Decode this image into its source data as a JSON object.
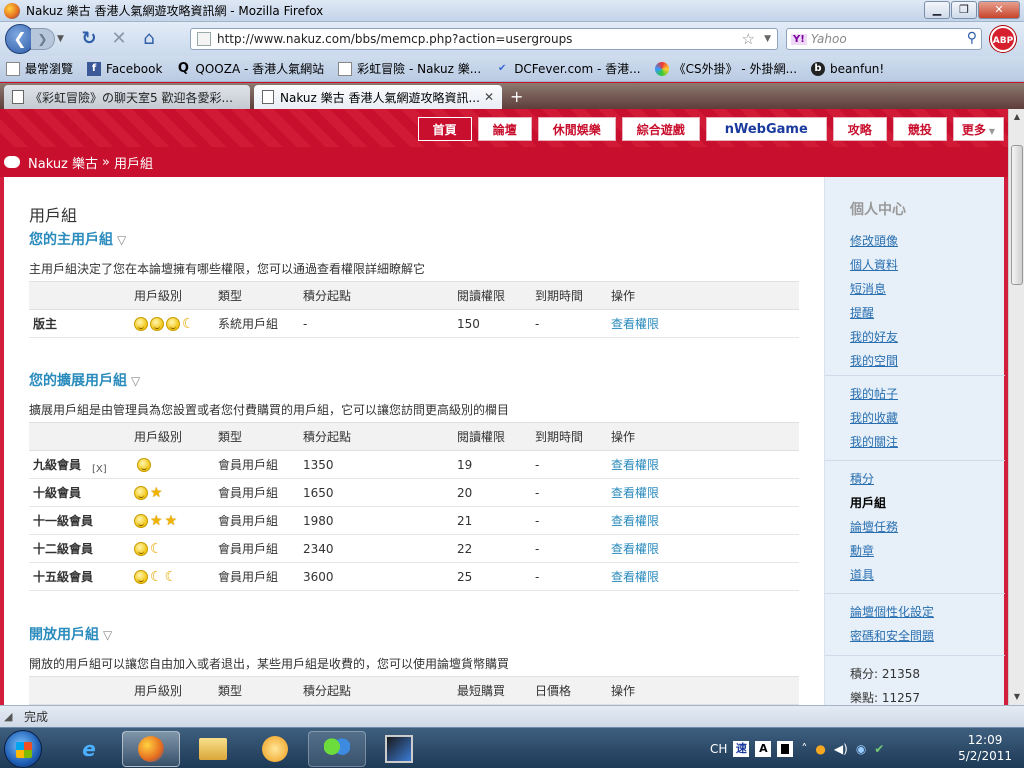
{
  "window": {
    "title": "Nakuz 樂古 香港人氣網遊攻略資訊網 - Mozilla Firefox",
    "minimize": "▁",
    "restore": "❐",
    "close": "✕"
  },
  "toolbar": {
    "back": "❮",
    "forward": "❯",
    "history_dropdown": "▼",
    "reload": "↻",
    "stop": "✕",
    "home": "⌂",
    "url": "http://www.nakuz.com/bbs/memcp.php?action=usergroups",
    "bookmark_star": "☆",
    "url_dropdown": "▼",
    "search_engine": "Y!",
    "search_placeholder": "Yahoo",
    "search_go": "⚲",
    "abp": "ABP"
  },
  "bookmarks": [
    {
      "label": "最常瀏覽",
      "icon": "bookmark-page-icon"
    },
    {
      "label": "Facebook",
      "icon": "facebook-icon"
    },
    {
      "label": "QOOZA - 香港人氣網站",
      "icon": "qooza-icon"
    },
    {
      "label": "彩虹冒險 - Nakuz 樂...",
      "icon": "page-icon"
    },
    {
      "label": "DCFever.com - 香港...",
      "icon": "dcfever-icon"
    },
    {
      "label": "《CS外掛》 - 外掛網...",
      "icon": "cs-icon"
    },
    {
      "label": "beanfun!",
      "icon": "beanfun-icon"
    }
  ],
  "bookmark_glyphs": {
    "fb": "f",
    "q": "Q",
    "dc": "✔",
    "bf": "b"
  },
  "tabs": [
    {
      "label": "《彩虹冒險》の聊天室5 歡迎各愛彩...",
      "close": "✕",
      "active": false
    },
    {
      "label": "Nakuz 樂古 香港人氣網遊攻略資訊...",
      "close": "✕",
      "active": true
    }
  ],
  "new_tab": "+",
  "site_menu": [
    {
      "label": "首頁",
      "current": true
    },
    {
      "label": "論壇",
      "current": false
    },
    {
      "label": "休閒娛樂",
      "current": false
    },
    {
      "label": "綜合遊戲",
      "current": false
    },
    {
      "label": "nWebGame",
      "current": false
    },
    {
      "label": "攻略",
      "current": false
    },
    {
      "label": "競投",
      "current": false
    },
    {
      "label": "更多",
      "current": false
    }
  ],
  "more_caret": "▼",
  "breadcrumb": {
    "site": "Nakuz 樂古",
    "sep": "»",
    "page": "用戶組"
  },
  "page": {
    "title": "用戶組",
    "tri": "▽",
    "columns": [
      "用戶級別",
      "類型",
      "積分起點",
      "閱讀權限",
      "到期時間",
      "操作"
    ],
    "open_columns": [
      "用戶級別",
      "類型",
      "積分起點",
      "最短購買",
      "日價格",
      "操作"
    ],
    "main_group": {
      "heading": "您的主用戶組",
      "desc": "主用戶組決定了您在本論壇擁有哪些權限，您可以通過查看權限詳細瞭解它",
      "rows": [
        {
          "name": "版主",
          "type": "系統用戶組",
          "points": "-",
          "read": "150",
          "expire": "-",
          "action": "查看權限",
          "icons": [
            "face",
            "face",
            "face",
            "moon"
          ]
        }
      ]
    },
    "ext_group": {
      "heading": "您的擴展用戶組",
      "desc": "擴展用戶組是由管理員為您設置或者您付費購買的用戶組，它可以讓您訪問更高級別的欄目",
      "x_mark": "[X]",
      "rows": [
        {
          "name": "九級會員",
          "type": "會員用戶組",
          "points": "1350",
          "read": "19",
          "expire": "-",
          "action": "查看權限",
          "icons": [
            "face"
          ]
        },
        {
          "name": "十級會員",
          "type": "會員用戶組",
          "points": "1650",
          "read": "20",
          "expire": "-",
          "action": "查看權限",
          "icons": [
            "face",
            "star"
          ]
        },
        {
          "name": "十一級會員",
          "type": "會員用戶組",
          "points": "1980",
          "read": "21",
          "expire": "-",
          "action": "查看權限",
          "icons": [
            "face",
            "star",
            "star"
          ]
        },
        {
          "name": "十二級會員",
          "type": "會員用戶組",
          "points": "2340",
          "read": "22",
          "expire": "-",
          "action": "查看權限",
          "icons": [
            "face",
            "moon"
          ]
        },
        {
          "name": "十五級會員",
          "type": "會員用戶組",
          "points": "3600",
          "read": "25",
          "expire": "-",
          "action": "查看權限",
          "icons": [
            "face",
            "moon",
            "moon"
          ]
        }
      ]
    },
    "open_group": {
      "heading": "開放用戶組",
      "desc": "開放的用戶組可以讓您自由加入或者退出，某些用戶組是收費的，您可以使用論壇貨幣購買"
    }
  },
  "sidebar": {
    "heading": "個人中心",
    "group1": [
      "修改頭像",
      "個人資料",
      "短消息",
      "提醒",
      "我的好友",
      "我的空間"
    ],
    "group2": [
      "我的帖子",
      "我的收藏",
      "我的關注"
    ],
    "group3": [
      "積分",
      "用戶組",
      "論壇任務",
      "勳章",
      "道具"
    ],
    "group3_current": "用戶組",
    "group4": [
      "論壇個性化設定",
      "密碼和安全問題"
    ],
    "stats": [
      {
        "label": "積分:",
        "value": "21358"
      },
      {
        "label": "樂點:",
        "value": "11257"
      }
    ]
  },
  "status": {
    "text": "完成"
  },
  "taskbar": {
    "ie": "e",
    "tray": {
      "lang": "CH",
      "ime1": "速",
      "ime2": "A",
      "caret": "˄",
      "vol": "◀)",
      "time": "12:09",
      "date": "5/2/2011"
    }
  }
}
